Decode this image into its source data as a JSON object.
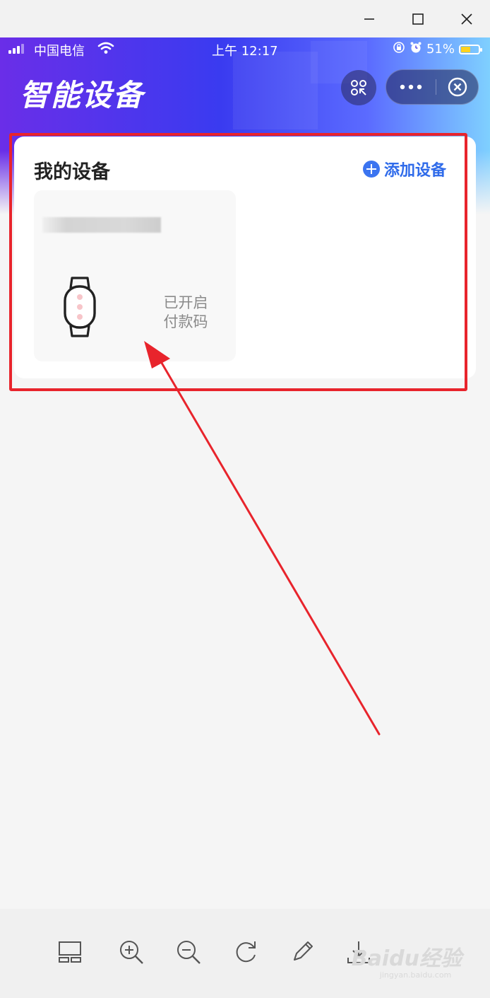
{
  "window": {
    "controls": [
      "minimize",
      "maximize",
      "close"
    ]
  },
  "status_bar": {
    "carrier": "中国电信",
    "time": "上午 12:17",
    "battery_percent": "51%",
    "battery_level": 0.51,
    "battery_color": "#ffd21f"
  },
  "header": {
    "title": "智能设备",
    "scan_icon": "scan-icon",
    "more_icon": "more-dots-icon",
    "close_icon": "close-circle-icon"
  },
  "devices_card": {
    "title": "我的设备",
    "add_label": "添加设备",
    "device": {
      "status_line1": "已开启",
      "status_line2": "付款码",
      "icon": "watch-icon"
    }
  },
  "toolbar": {
    "icons": [
      "layout-icon",
      "zoom-in-icon",
      "zoom-out-icon",
      "rotate-icon",
      "edit-pencil-icon",
      "download-icon"
    ]
  },
  "watermark": {
    "brand": "Baidu经验",
    "url": "jingyan.baidu.com"
  },
  "colors": {
    "accent_blue": "#2f6bea",
    "highlight_red": "#e8242c",
    "hero_purple": "#6a2ee8"
  }
}
